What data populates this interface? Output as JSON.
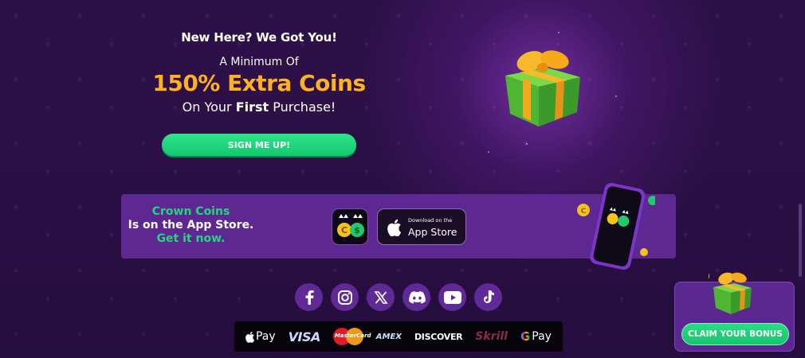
{
  "hero": {
    "heading": "New Here? We Got You!",
    "line2": "A Minimum Of",
    "offer": "150% Extra Coins",
    "line3_pre": "On Your ",
    "line3_bold": "First",
    "line3_post": " Purchase!",
    "signup_label": "SIGN ME UP!"
  },
  "app_banner": {
    "line1": "Crown Coins",
    "line2": "Is on the App Store.",
    "line3": "Get it now.",
    "store_small": "Download on the",
    "store_big": "App Store"
  },
  "socials": [
    "facebook-icon",
    "instagram-icon",
    "x-icon",
    "discord-icon",
    "youtube-icon",
    "tiktok-icon"
  ],
  "payments": {
    "apple_pay": "Pay",
    "visa": "VISA",
    "mastercard": "MasterCard",
    "amex": "AMEX",
    "discover": "DISCOVER",
    "skrill": "Skrill",
    "google_pay": "Pay"
  },
  "bonus": {
    "claim_label": "CLAIM YOUR BONUS"
  },
  "colors": {
    "background": "#2a0f44",
    "accent_gold": "#ffb21e",
    "accent_green": "#1fd27a",
    "banner_purple": "#5d2891"
  }
}
